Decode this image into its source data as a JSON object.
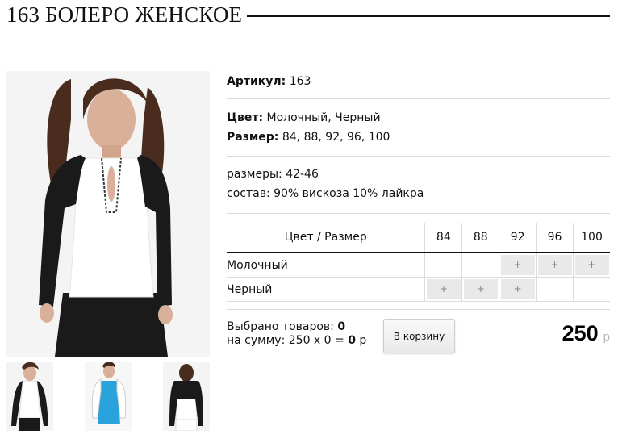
{
  "product": {
    "title": "163 БОЛЕРО ЖЕНСКОЕ",
    "article_label": "Артикул:",
    "article_value": "163",
    "color_label": "Цвет:",
    "color_value": "Молочный, Черный",
    "size_label": "Размер:",
    "size_value": "84, 88, 92, 96, 100",
    "sizes_range": "размеры: 42-46",
    "composition": "состав: 90% вискоза 10% лайкра"
  },
  "grid": {
    "header_label": "Цвет / Размер",
    "sizes": [
      "84",
      "88",
      "92",
      "96",
      "100"
    ],
    "rows": [
      {
        "color": "Молочный",
        "cells": [
          "",
          "",
          "+",
          "+",
          "+"
        ]
      },
      {
        "color": "Черный",
        "cells": [
          "+",
          "+",
          "+",
          "",
          ""
        ]
      }
    ]
  },
  "summary": {
    "selected_label": "Выбрано товаров:",
    "selected_count": "0",
    "sum_label": "на сумму:",
    "sum_expr": "250 x 0 =",
    "sum_total": "0",
    "sum_currency": "р"
  },
  "cart_button": "В корзину",
  "price": {
    "value": "250",
    "currency": "р"
  },
  "colors": {
    "jacket": "#1a1a1a",
    "blouse": "#ffffff",
    "skin": "#d9b099",
    "hair": "#4a2c1f",
    "blue_top": "#2aa3dc"
  }
}
